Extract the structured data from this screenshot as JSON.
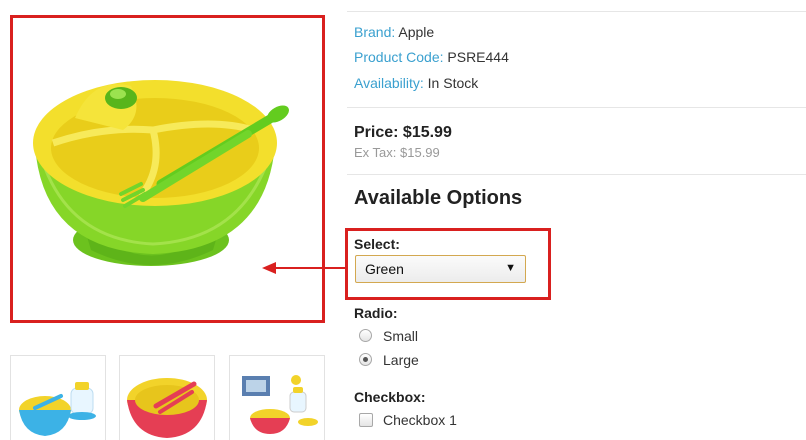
{
  "product": {
    "brand_label": "Brand:",
    "brand_value": "Apple",
    "code_label": "Product Code:",
    "code_value": "PSRE444",
    "availability_label": "Availability:",
    "availability_value": "In Stock",
    "price": "Price: $15.99",
    "ex_tax": "Ex Tax: $15.99"
  },
  "options": {
    "title": "Available Options",
    "select": {
      "label": "Select:",
      "value": "Green",
      "arrow": "▼"
    },
    "radio": {
      "label": "Radio:",
      "items": [
        {
          "label": "Small",
          "checked": false
        },
        {
          "label": "Large",
          "checked": true
        }
      ]
    },
    "checkbox": {
      "label": "Checkbox:",
      "items": [
        {
          "label": "Checkbox 1",
          "checked": false
        }
      ]
    }
  },
  "colors": {
    "highlight": "#d9201f",
    "meta_key": "#3aa0cf",
    "product_green": "#7ed321",
    "product_yellow": "#f5e028"
  },
  "gallery": {
    "main_image": "green-yellow-suction-bowl-with-fork-and-spoon",
    "thumbnails": [
      "blue-bowl-set",
      "pink-bowl-set",
      "boxed-feeding-set"
    ]
  }
}
